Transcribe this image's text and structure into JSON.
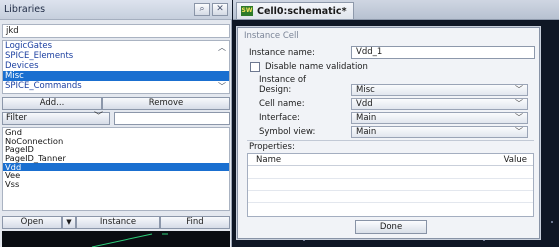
{
  "libraries": {
    "title": "Libraries",
    "current_library": "jkd",
    "library_list": [
      "LogicGates",
      "SPICE_Elements",
      "Devices",
      "Misc",
      "SPICE_Commands"
    ],
    "selected_library_index": 3,
    "add_label": "Add...",
    "remove_label": "Remove",
    "filter_label": "Filter",
    "filter_value": "",
    "cells": [
      "Gnd",
      "NoConnection",
      "PageID",
      "PageID_Tanner",
      "Vdd",
      "Vee",
      "Vss"
    ],
    "selected_cell_index": 4,
    "open_label": "Open",
    "instance_label": "Instance",
    "find_label": "Find"
  },
  "schematic": {
    "tab_title": "Cell0:schematic*",
    "tab_icon_text": "SW"
  },
  "dialog": {
    "title": "Instance Cell",
    "instance_name_label": "Instance name:",
    "instance_name_value": "Vdd_1",
    "disable_validation_label": "Disable name validation",
    "disable_validation_checked": false,
    "instance_of_label": "Instance of",
    "design_label": "Design:",
    "design_value": "Misc",
    "cell_name_label": "Cell name:",
    "cell_name_value": "Vdd",
    "interface_label": "Interface:",
    "interface_value": "Main",
    "symbol_view_label": "Symbol view:",
    "symbol_view_value": "Main",
    "properties_label": "Properties:",
    "props_col_name": "Name",
    "props_col_value": "Value",
    "done_label": "Done"
  },
  "colors": {
    "selection_blue": "#1a6fd0",
    "library_link_blue": "#1b3fa0",
    "canvas_dark": "#0f1725"
  }
}
